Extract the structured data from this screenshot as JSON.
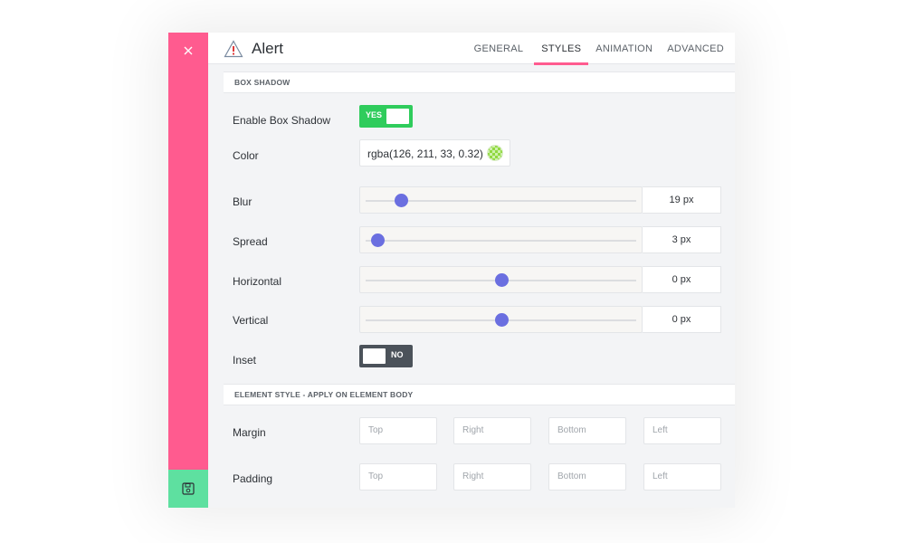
{
  "header": {
    "title": "Alert",
    "tabs": [
      {
        "label": "GENERAL",
        "active": false
      },
      {
        "label": "STYLES",
        "active": true
      },
      {
        "label": "ANIMATION",
        "active": false
      },
      {
        "label": "ADVANCED",
        "active": false
      }
    ]
  },
  "sidebar": {
    "close_icon": "close-icon",
    "save_icon": "save-icon"
  },
  "sections": {
    "box_shadow": "BOX SHADOW",
    "element_style": "ELEMENT STYLE - APPLY ON ELEMENT BODY"
  },
  "box_shadow": {
    "enable": {
      "label": "Enable Box Shadow",
      "state": "YES"
    },
    "color": {
      "label": "Color",
      "value": "rgba(126, 211, 33, 0.32)"
    },
    "blur": {
      "label": "Blur",
      "value": "19 px",
      "position": 0.12
    },
    "spread": {
      "label": "Spread",
      "value": "3 px",
      "position": 0.03
    },
    "horizontal": {
      "label": "Horizontal",
      "value": "0 px",
      "position": 0.5
    },
    "vertical": {
      "label": "Vertical",
      "value": "0 px",
      "position": 0.5
    },
    "inset": {
      "label": "Inset",
      "state": "NO"
    }
  },
  "element_style": {
    "margin": {
      "label": "Margin",
      "top": "Top",
      "right": "Right",
      "bottom": "Bottom",
      "left": "Left"
    },
    "padding": {
      "label": "Padding",
      "top": "Top",
      "right": "Right",
      "bottom": "Bottom",
      "left": "Left"
    }
  },
  "colors": {
    "sidebar": "#ff5b8f",
    "save": "#5ee0a0",
    "toggle_on": "#2fcc5c",
    "toggle_off": "#4b525a",
    "slider_thumb": "#6b6fe0"
  }
}
